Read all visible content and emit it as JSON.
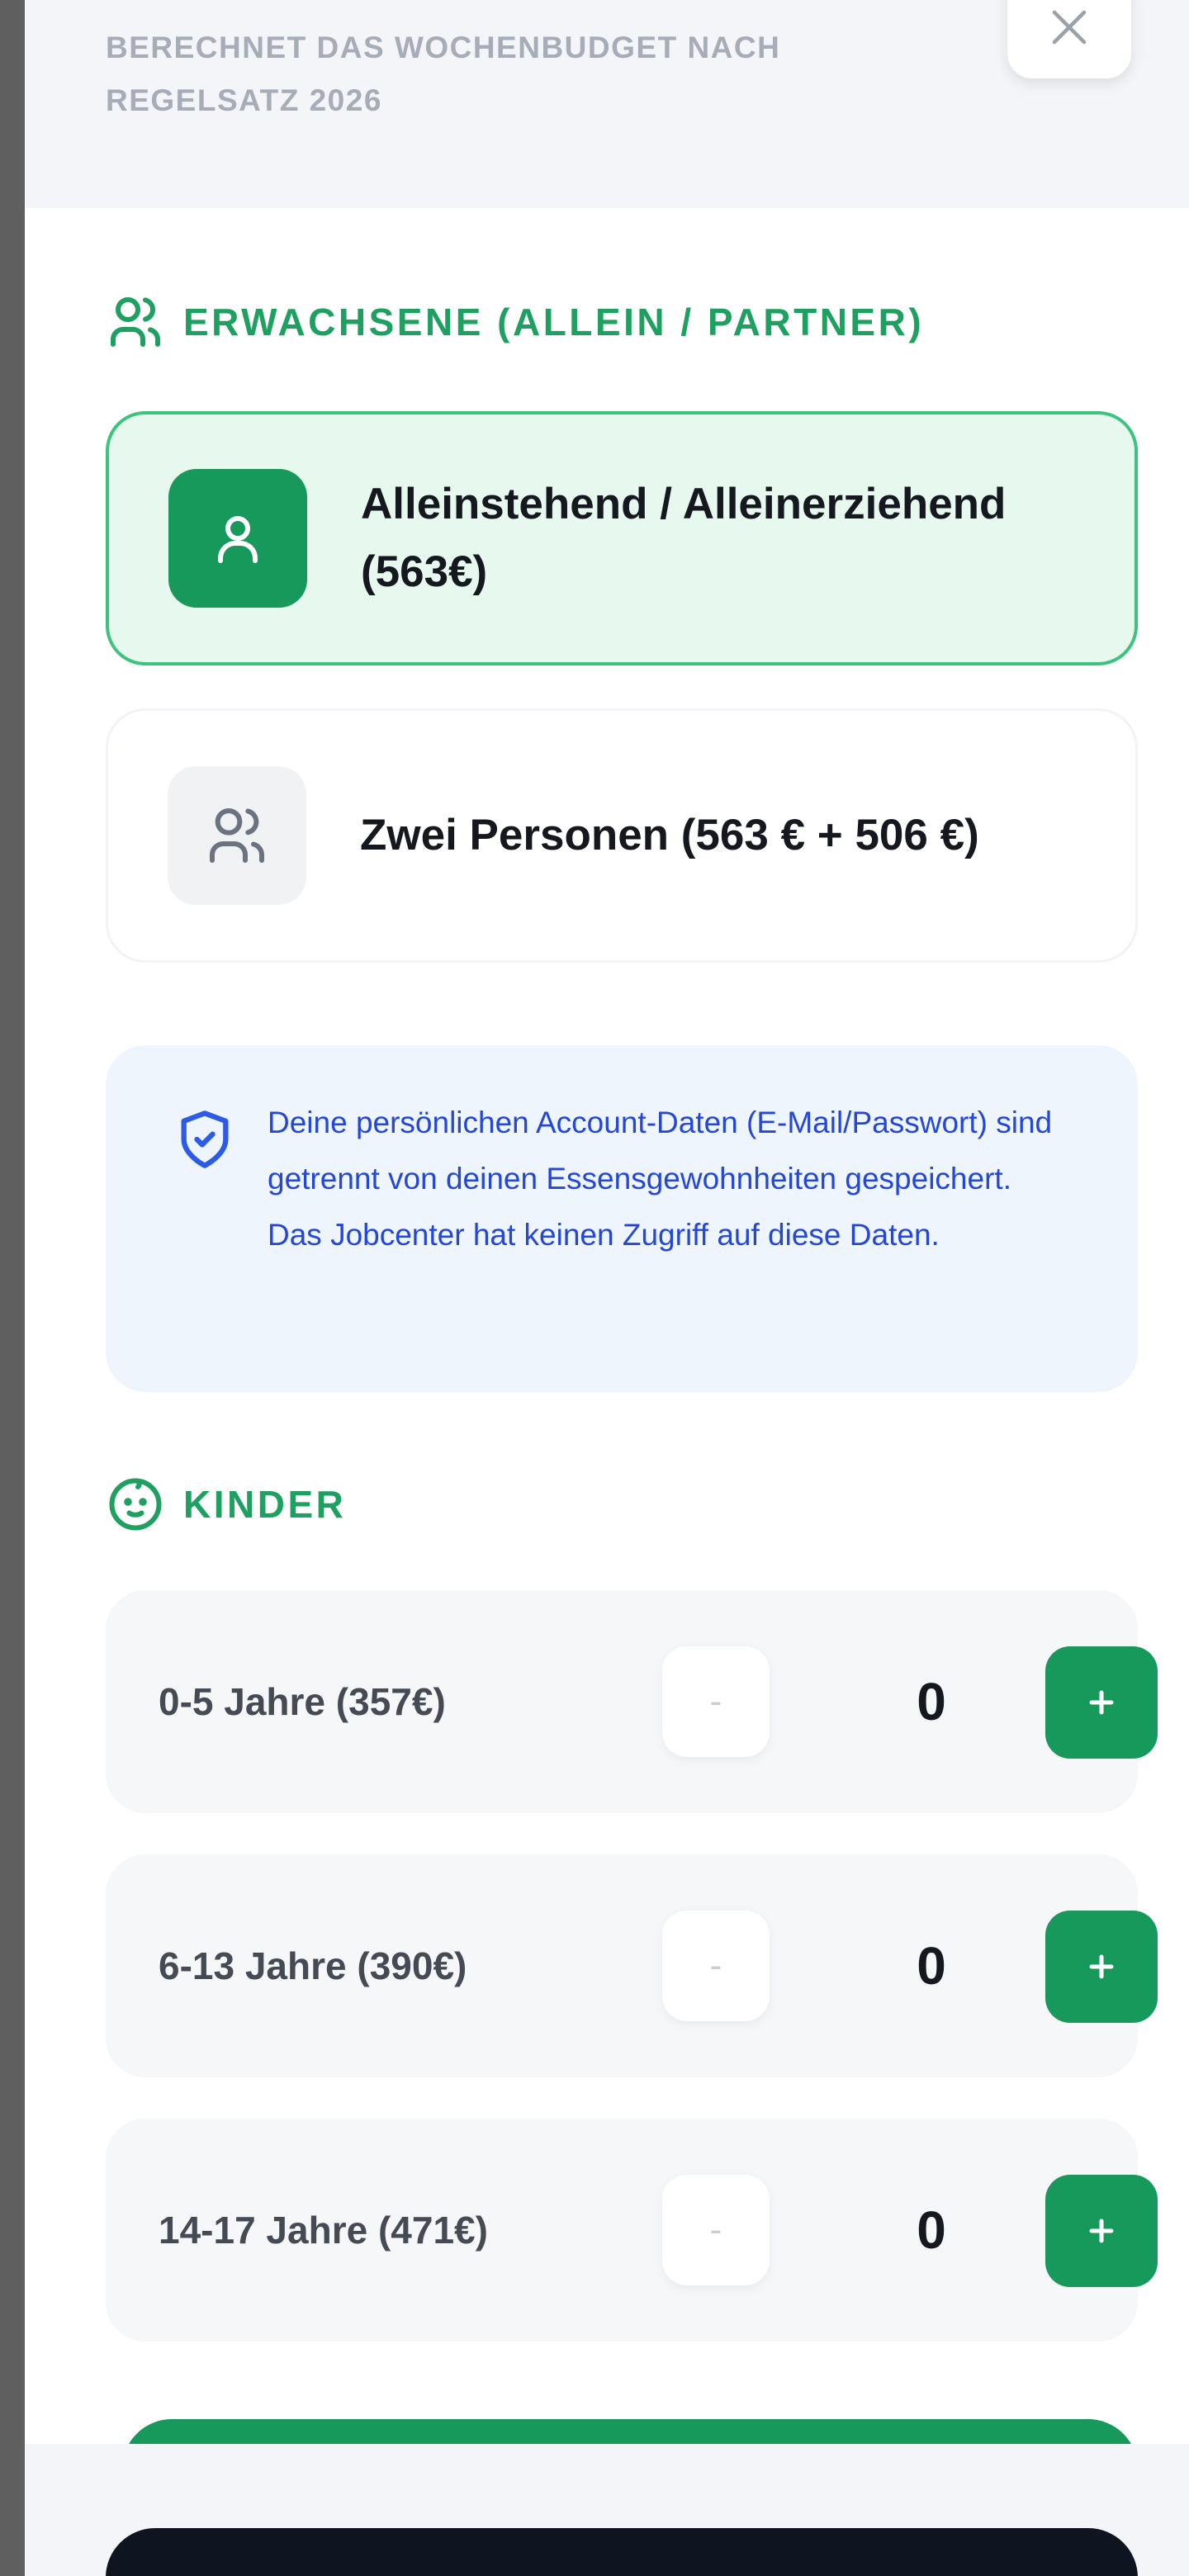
{
  "header": {
    "subtitle": "BERECHNET DAS WOCHENBUDGET NACH REGELSATZ 2026",
    "close_icon": "close-icon"
  },
  "adults": {
    "heading": "ERWACHSENE (ALLEIN / PARTNER)",
    "heading_icon": "users-icon",
    "options": [
      {
        "label": "Alleinstehend / Alleinerziehend (563€)",
        "icon": "user-icon",
        "selected": true
      },
      {
        "label": "Zwei Personen (563 € + 506 €)",
        "icon": "users-icon",
        "selected": false
      }
    ]
  },
  "privacy": {
    "icon": "shield-check-icon",
    "text": "Deine persönlichen Account-Daten (E-Mail/Passwort) sind getrennt von deinen Essensgewohnheiten gespeichert. Das Jobcenter hat keinen Zugriff auf diese Daten."
  },
  "children": {
    "heading": "KINDER",
    "heading_icon": "baby-icon",
    "rows": [
      {
        "label": "0-5 Jahre (357€)",
        "count": "0",
        "minus": "-",
        "plus": "+"
      },
      {
        "label": "6-13 Jahre (390€)",
        "count": "0",
        "minus": "-",
        "plus": "+"
      },
      {
        "label": "14-17 Jahre (471€)",
        "count": "0",
        "minus": "-",
        "plus": "+"
      }
    ]
  },
  "colors": {
    "accent_green": "#16995a",
    "selected_bg": "#e7f8ef",
    "info_text": "#2447d8",
    "dark_button": "#0e1521"
  }
}
